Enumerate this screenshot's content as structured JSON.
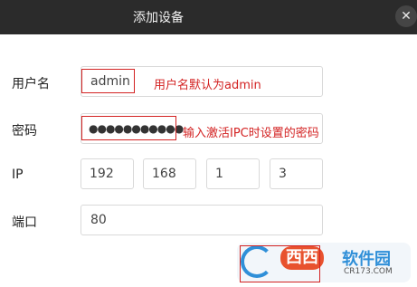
{
  "dialog": {
    "title": "添加设备",
    "close_glyph": "✕"
  },
  "form": {
    "username": {
      "label": "用户名",
      "value": "admin",
      "annotation": "用户名默认为admin"
    },
    "password": {
      "label": "密码",
      "value": "●●●●●●●●●●●",
      "annotation": "输入激活IPC时设置的密码"
    },
    "ip": {
      "label": "IP",
      "octets": [
        "192",
        "168",
        "1",
        "3"
      ]
    },
    "port": {
      "label": "端口",
      "value": "80"
    }
  },
  "watermark": {
    "brand": "西西",
    "tagline": "软件园",
    "url": "CR173.COM"
  },
  "colors": {
    "titlebar": "#2b2b2b",
    "annotation_red": "#d32222",
    "field_border": "#d9d9d9"
  }
}
